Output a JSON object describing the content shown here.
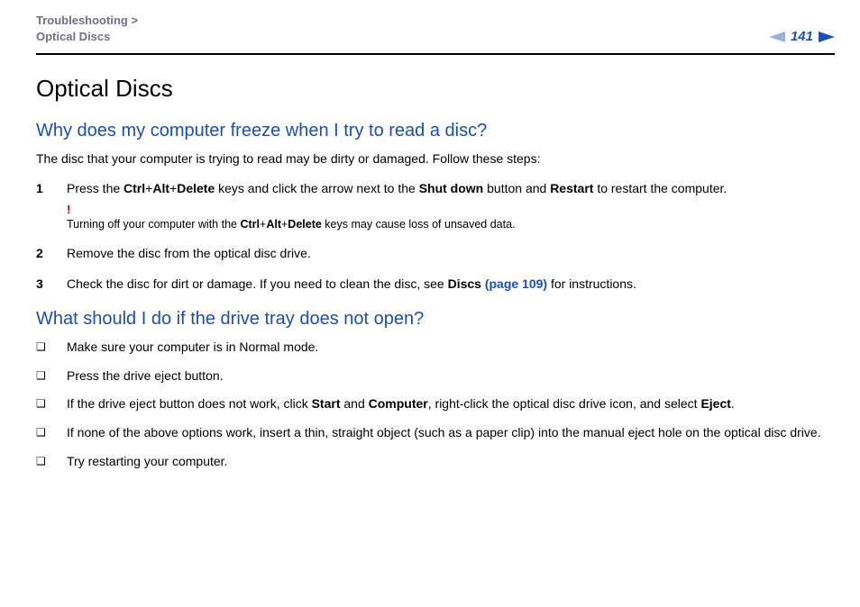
{
  "header": {
    "breadcrumb": {
      "section": "Troubleshooting",
      "sep": ">",
      "page": "Optical Discs"
    },
    "page_number": "141"
  },
  "title": "Optical Discs",
  "section1": {
    "heading": "Why does my computer freeze when I try to read a disc?",
    "intro": "The disc that your computer is trying to read may be dirty or damaged. Follow these steps:",
    "steps": [
      {
        "n": "1",
        "pre": "Press the ",
        "k1": "Ctrl",
        "p1": "+",
        "k2": "Alt",
        "p2": "+",
        "k3": "Delete",
        "mid": " keys and click the arrow next to the ",
        "b1": "Shut down",
        "mid2": " button and ",
        "b2": "Restart",
        "post": " to restart the computer.",
        "warn_mark": "!",
        "warn": "Turning off your computer with the ",
        "wk1": "Ctrl",
        "wp1": "+",
        "wk2": "Alt",
        "wp2": "+",
        "wk3": "Delete",
        "warn2": " keys may cause loss of unsaved data."
      },
      {
        "n": "2",
        "text": "Remove the disc from the optical disc drive."
      },
      {
        "n": "3",
        "pre": "Check the disc for dirt or damage. If you need to clean the disc, see ",
        "b1": "Discs ",
        "link": "(page 109)",
        "post": " for instructions."
      }
    ]
  },
  "section2": {
    "heading": "What should I do if the drive tray does not open?",
    "items": [
      {
        "text": "Make sure your computer is in Normal mode."
      },
      {
        "text": "Press the drive eject button."
      },
      {
        "pre": "If the drive eject button does not work, click ",
        "b1": "Start",
        "mid": " and ",
        "b2": "Computer",
        "mid2": ", right-click the optical disc drive icon, and select ",
        "b3": "Eject",
        "post": "."
      },
      {
        "text": "If none of the above options work, insert a thin, straight object (such as a paper clip) into the manual eject hole on the optical disc drive."
      },
      {
        "text": "Try restarting your computer."
      }
    ]
  },
  "bullet": "❑"
}
